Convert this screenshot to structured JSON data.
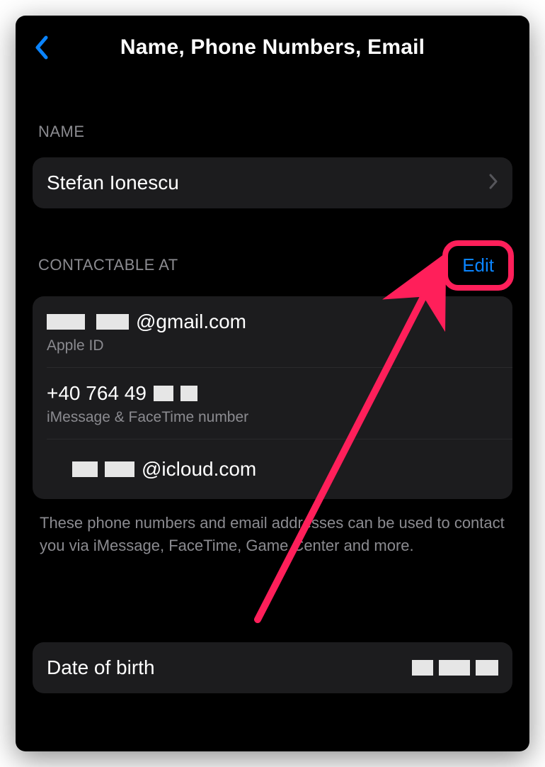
{
  "header": {
    "title": "Name, Phone Numbers, Email"
  },
  "sections": {
    "name": {
      "label": "NAME",
      "value": "Stefan Ionescu"
    },
    "contactable": {
      "label": "CONTACTABLE AT",
      "edit_label": "Edit",
      "items": [
        {
          "value_suffix": "@gmail.com",
          "subtitle": "Apple ID"
        },
        {
          "value_prefix": "+40 764 49",
          "subtitle": "iMessage & FaceTime number"
        },
        {
          "value_suffix": "@icloud.com"
        }
      ],
      "footer": "These phone numbers and email addresses can be used to contact you via iMessage, FaceTime, Game Center and more."
    },
    "dob": {
      "label": "Date of birth"
    }
  },
  "colors": {
    "accent": "#0a84ff",
    "highlight": "#ff1f5a"
  }
}
